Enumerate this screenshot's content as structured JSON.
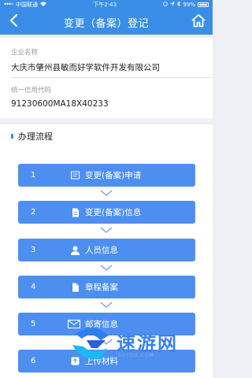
{
  "status_bar": {
    "carrier": "中国联通",
    "time": "下午2:43",
    "battery": "99%"
  },
  "header": {
    "title": "变更（备案）登记"
  },
  "company": {
    "name_label": "企业名称",
    "name_value": "大庆市肇州县敏而好学软件开发有限公司",
    "code_label": "统一信用代码",
    "code_value": "91230600MA18X40233"
  },
  "process": {
    "title": "办理流程",
    "steps": [
      {
        "num": "1",
        "label": "变更(备案)申请",
        "icon": "form-icon"
      },
      {
        "num": "2",
        "label": "变更(备案)信息",
        "icon": "document-icon"
      },
      {
        "num": "3",
        "label": "人员信息",
        "icon": "person-icon"
      },
      {
        "num": "4",
        "label": "章程备案",
        "icon": "file-icon"
      },
      {
        "num": "5",
        "label": "邮寄信息",
        "icon": "mail-icon"
      },
      {
        "num": "6",
        "label": "上传材料",
        "icon": "upload-icon"
      }
    ]
  },
  "watermark": {
    "text": "速游网",
    "sub": "SUYOU.COM"
  },
  "colors": {
    "primary": "#3a8ee8",
    "step": "#4d8ff0",
    "background": "#eef0f5"
  }
}
